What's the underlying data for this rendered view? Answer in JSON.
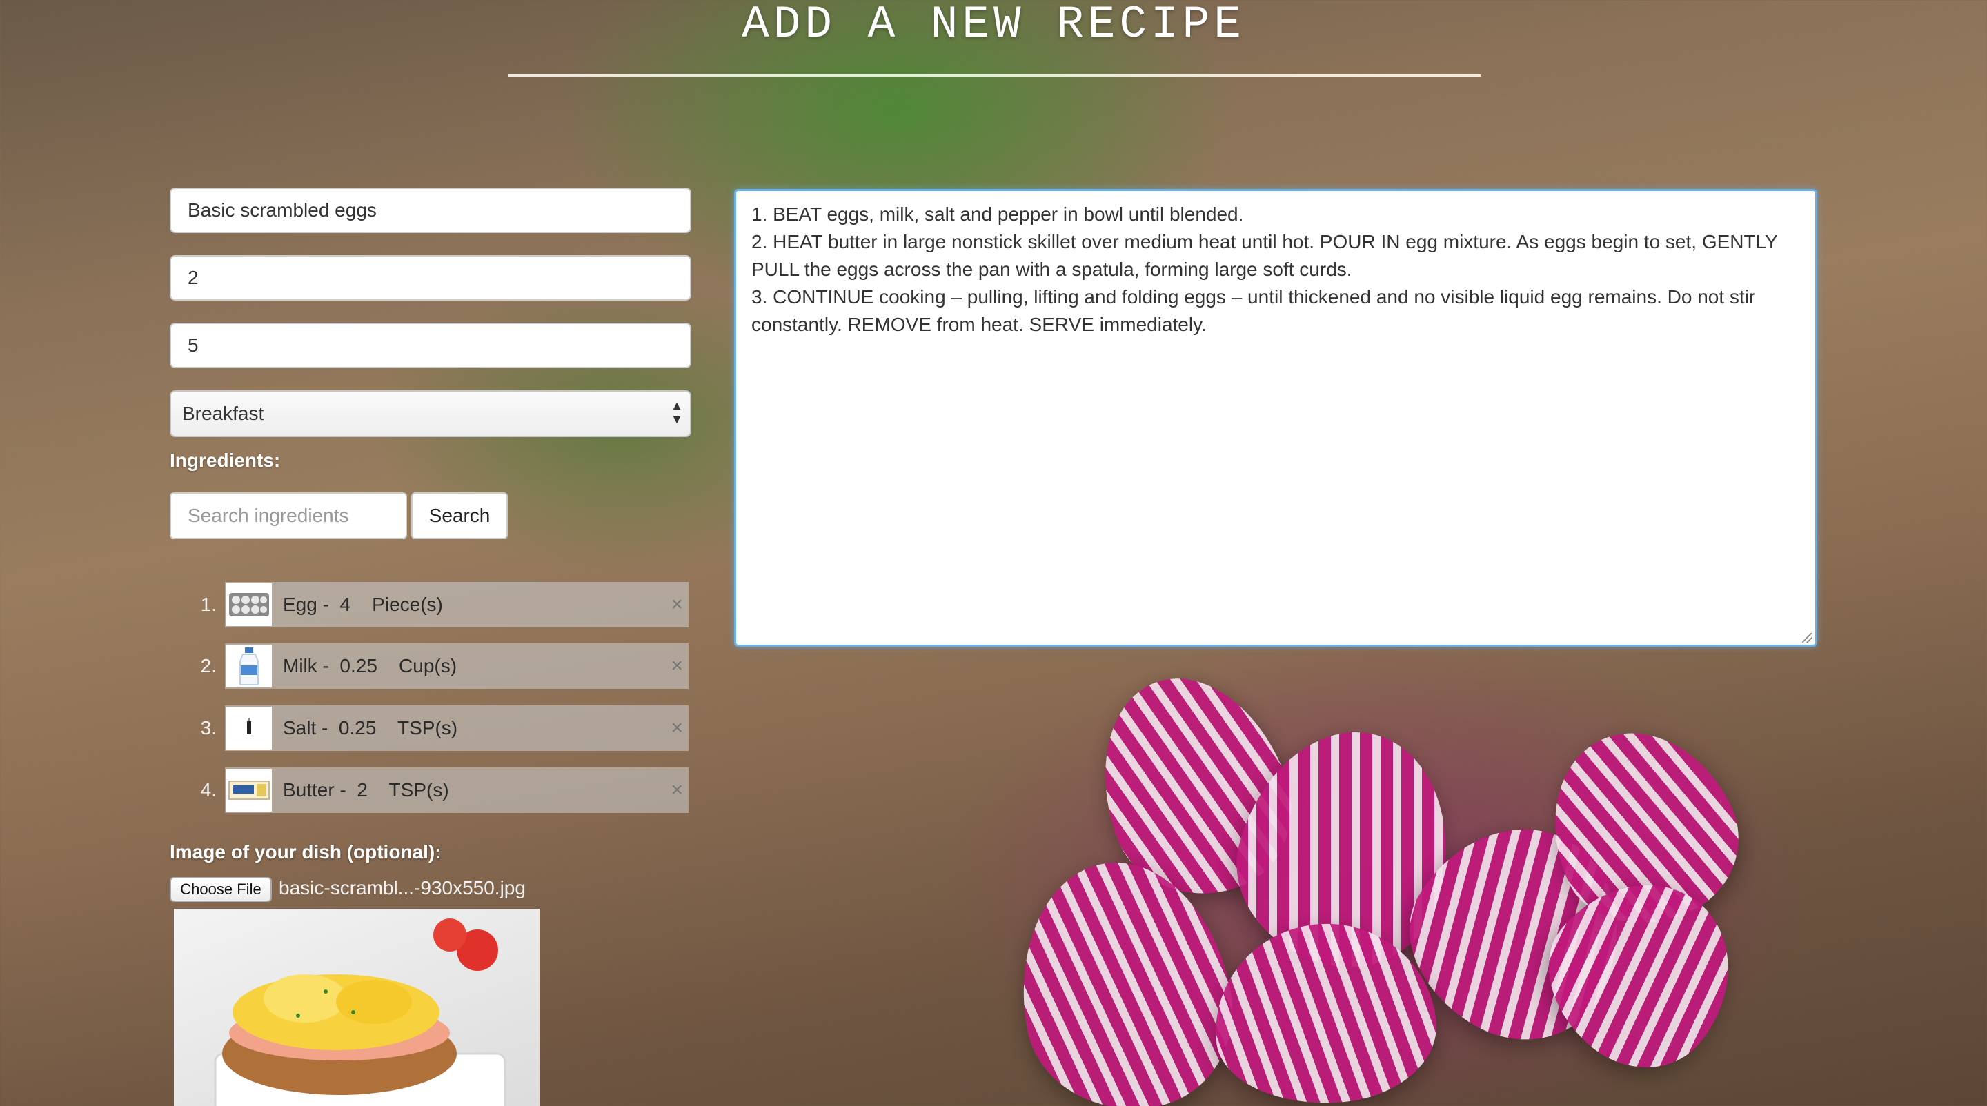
{
  "page": {
    "title": "ADD A NEW RECIPE"
  },
  "form": {
    "recipe_name": "Basic scrambled eggs",
    "servings": "2",
    "time": "5",
    "category": "Breakfast",
    "ingredients_label": "Ingredients:",
    "search_placeholder": "Search ingredients",
    "search_button": "Search",
    "image_label": "Image of your dish (optional):",
    "choose_file_button": "Choose File",
    "file_name": "basic-scrambl...-930x550.jpg"
  },
  "ingredients": [
    {
      "num": "1.",
      "text": "Egg -  4    Piece(s)",
      "icon": "egg-carton-icon",
      "remove": "×"
    },
    {
      "num": "2.",
      "text": "Milk -  0.25    Cup(s)",
      "icon": "milk-bottle-icon",
      "remove": "×"
    },
    {
      "num": "3.",
      "text": "Salt -  0.25    TSP(s)",
      "icon": "salt-shaker-icon",
      "remove": "×"
    },
    {
      "num": "4.",
      "text": "Butter -  2    TSP(s)",
      "icon": "butter-box-icon",
      "remove": "×"
    }
  ],
  "instructions": "1. BEAT eggs, milk, salt and pepper in bowl until blended.\n2. HEAT butter in large nonstick skillet over medium heat until hot. POUR IN egg mixture. As eggs begin to set, GENTLY PULL the eggs across the pan with a spatula, forming large soft curds.\n3. CONTINUE cooking – pulling, lifting and folding eggs – until thickened and no visible liquid egg remains. Do not stir constantly. REMOVE from heat. SERVE immediately.",
  "colors": {
    "focus_border": "#66afe9",
    "ingredient_bar": "rgba(200,200,200,0.6)"
  }
}
